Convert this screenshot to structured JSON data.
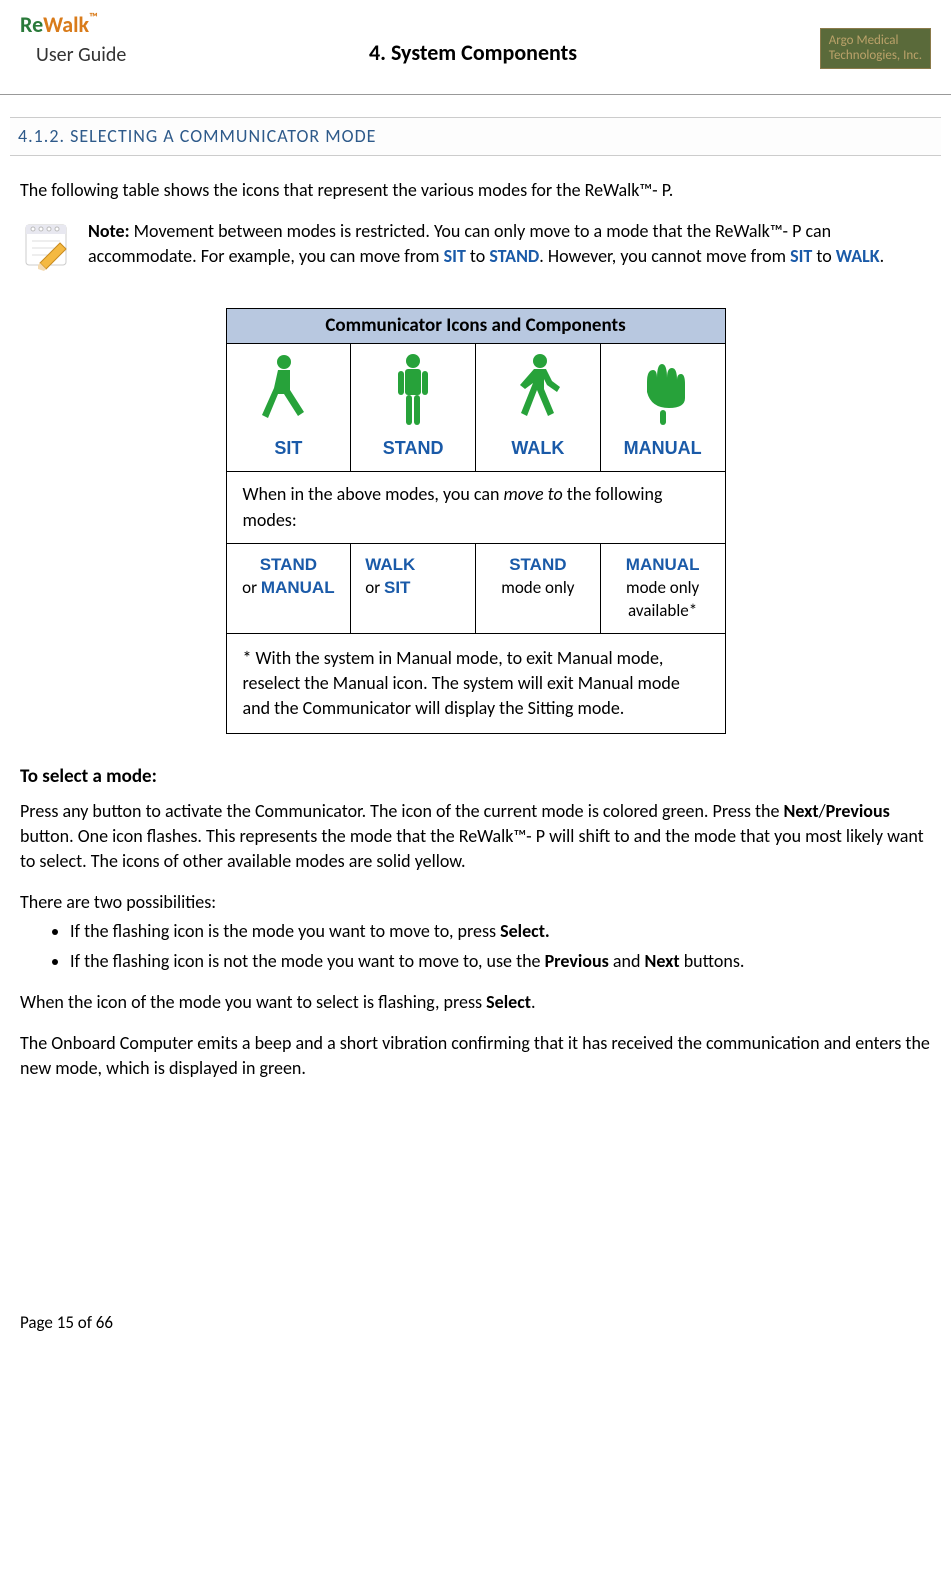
{
  "header": {
    "logo_re": "Re",
    "logo_walk": "Walk",
    "logo_tm": "™",
    "user_guide": "User Guide",
    "section": "4. System Components",
    "company_l1": "Argo Medical",
    "company_l2": "Technologies, Inc."
  },
  "subsection": "4.1.2. SELECTING A COMMUNICATOR MODE",
  "intro": "The following table shows the icons that represent the various modes for the ReWalk™- P.",
  "note": {
    "label": "Note:",
    "part1": " Movement between modes is restricted.  You can only move to a mode that the ReWalk™- P can accommodate.  For example, you can move from ",
    "sit": "SIT",
    "to1": " to ",
    "stand": "STAND",
    "part2": ".  However, you cannot move from ",
    "sit2": "SIT",
    "to2": " to ",
    "walk": "WALK",
    "end": "."
  },
  "table": {
    "header": "Communicator Icons and Components",
    "modes": {
      "sit": "SIT",
      "stand": "STAND",
      "walk": "WALK",
      "manual": "MANUAL"
    },
    "desc_pre": "When in the above modes, you can ",
    "desc_em": "move to",
    "desc_post": " the following modes:",
    "trans": {
      "c1_a": "STAND",
      "c1_mid": "or ",
      "c1_b": "MANUAL",
      "c2_a": "WALK",
      "c2_mid": "or ",
      "c2_b": "SIT",
      "c3_a": "STAND",
      "c3_b": "mode only",
      "c4_a": "MANUAL",
      "c4_b": "mode only available*"
    },
    "footnote": "* With the system in Manual mode, to exit Manual mode, reselect the Manual icon. The system will exit Manual mode and the Communicator will display the Sitting mode."
  },
  "select": {
    "heading": "To select a mode:",
    "p1_a": "Press any button to activate the Communicator. The icon of the current mode is colored green. Press the ",
    "p1_next": "Next",
    "p1_slash": "/",
    "p1_prev": "Previous",
    "p1_b": " button. One icon flashes. This represents the mode that the ReWalk™- P will shift to and the mode that you most likely want to select. The icons of other available modes are solid yellow.",
    "poss": "There are two possibilities:",
    "b1_a": "If the flashing icon is the mode you want to move to, press ",
    "b1_sel": "Select.",
    "b2_a": "If the flashing icon is not the mode you want to move to, use the ",
    "b2_prev": "Previous",
    "b2_and": " and ",
    "b2_next": "Next",
    "b2_b": " buttons.",
    "p2_a": "When the icon of the mode you want to select is flashing, press ",
    "p2_sel": "Select",
    "p2_b": ".",
    "p3": "The Onboard Computer emits a beep and a short vibration confirming that it has received the communication and enters the new mode, which is displayed in green."
  },
  "footer": "Page 15 of 66"
}
